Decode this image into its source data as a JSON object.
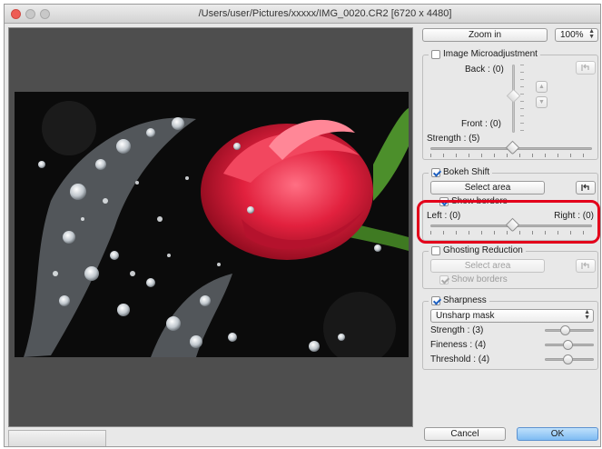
{
  "window": {
    "title": "/Users/user/Pictures/xxxxx/IMG_0020.CR2 [6720 x 4480]"
  },
  "toolbar": {
    "zoom_in_label": "Zoom in",
    "zoom_value": "100%"
  },
  "microadjustment": {
    "label": "Image Microadjustment",
    "checked": false,
    "back_label": "Back : (0)",
    "front_label": "Front : (0)",
    "strength_label": "Strength : (5)"
  },
  "bokeh": {
    "label": "Bokeh Shift",
    "checked": true,
    "select_area_label": "Select area",
    "show_borders_label": "Show borders",
    "left_label": "Left : (0)",
    "right_label": "Right : (0)"
  },
  "ghosting": {
    "label": "Ghosting Reduction",
    "checked": false,
    "select_area_label": "Select area",
    "show_borders_label": "Show borders"
  },
  "sharpness": {
    "label": "Sharpness",
    "checked": true,
    "mode": "Unsharp mask",
    "strength_label": "Strength : (3)",
    "fineness_label": "Fineness : (4)",
    "threshold_label": "Threshold : (4)"
  },
  "footer": {
    "cancel_label": "Cancel",
    "ok_label": "OK"
  },
  "colors": {
    "highlight": "#e3001b",
    "ok_button": "#7fbcf3"
  },
  "icons": [
    "close-window-icon",
    "minimize-window-icon",
    "zoom-window-icon",
    "reset-arrow-icon",
    "arrow-up-icon",
    "arrow-down-icon"
  ]
}
